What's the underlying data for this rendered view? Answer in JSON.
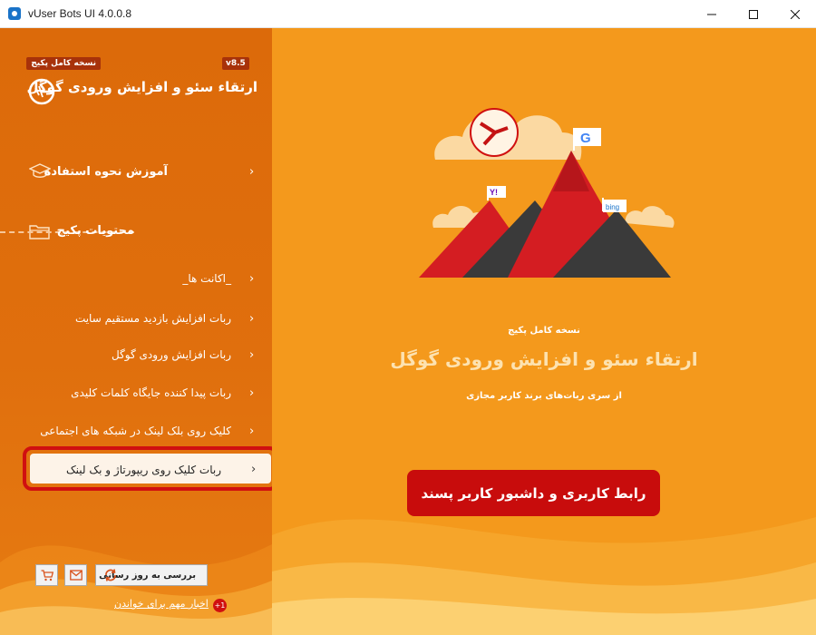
{
  "window": {
    "title": "vUser Bots UI 4.0.0.8",
    "controls": [
      "minimize-icon",
      "maximize-icon",
      "close-icon"
    ]
  },
  "sidebar": {
    "edition_badge": "نسخه کامل پکیج",
    "version_badge": "v8.5",
    "brand_title": "ارتقاء سئو و افزایش ورودی گوگل",
    "tutorial": {
      "label": "آموزش نحوه استفاده",
      "icon": "graduation-cap-icon"
    },
    "section": {
      "label": "محتویات پکیج",
      "icon": "folder-icon"
    },
    "items": [
      {
        "label": "_اکانت ها_"
      },
      {
        "label": "ربات افزایش بازدید مستقیم سایت"
      },
      {
        "label": "ربات افزایش ورودی گوگل"
      },
      {
        "label": "ربات پیدا کننده جایگاه کلمات کلیدی"
      },
      {
        "label": "کلیک روی بلک لینک در شبکه های اجتماعی"
      },
      {
        "label": "ربات کلیک روی ریپورتاژ و بک لینک",
        "active": true
      }
    ],
    "footer": {
      "update_button": "بررسی به روز رسانی",
      "news_link": "اخبار مهم برای خواندن",
      "news_badge": "+1"
    }
  },
  "main": {
    "small_caption": "نسخه کامل پکیج",
    "title": "ارتقاء سئو و افزایش ورودی گوگل",
    "subtitle": "از سری ربات‌های برند کاربر مجازی",
    "cta": "رابط کاربری و داشبور کاربر پسند",
    "flags": [
      "Y!",
      "bing"
    ]
  },
  "colors": {
    "sidebar": "#dc6a0a",
    "main": "#f4991c",
    "accent_red": "#c80c0c"
  }
}
